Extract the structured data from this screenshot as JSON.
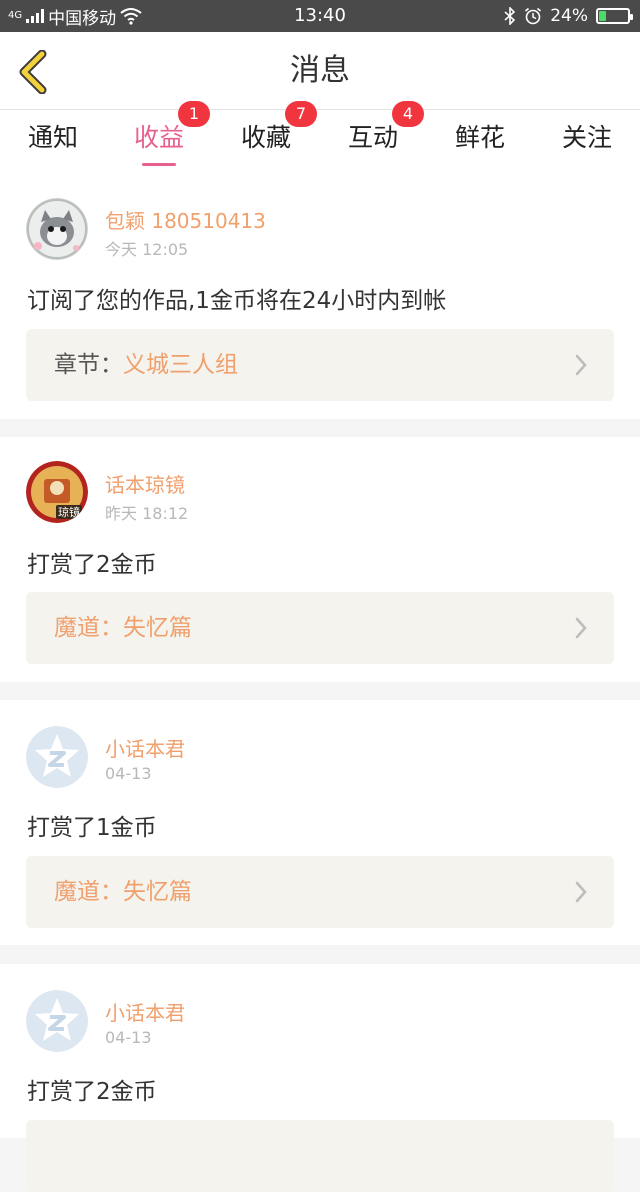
{
  "status": {
    "network": "4G",
    "carrier": "中国移动",
    "time": "13:40",
    "battery": "24%",
    "battery_level": 0.24
  },
  "header": {
    "back_icon": "chevron-left-icon",
    "title": "消息"
  },
  "tabs": [
    {
      "label": "通知",
      "badge": ""
    },
    {
      "label": "收益",
      "badge": "1",
      "active": true
    },
    {
      "label": "收藏",
      "badge": "7"
    },
    {
      "label": "互动",
      "badge": "4"
    },
    {
      "label": "鲜花",
      "badge": ""
    },
    {
      "label": "关注",
      "badge": ""
    }
  ],
  "messages": [
    {
      "user": "包颖 180510413",
      "time": "今天 12:05",
      "text": "订阅了您的作品,1金币将在24小时内到帐",
      "ref_prefix": "章节：",
      "ref_title": "义城三人组"
    },
    {
      "user": "话本琼镜",
      "time": "昨天 18:12",
      "avatar_text": "琼镜",
      "text": "打赏了2金币",
      "ref_prefix": "魔道：",
      "ref_title": "失忆篇"
    },
    {
      "user": "小话本君",
      "time": "04-13",
      "text": "打赏了1金币",
      "ref_prefix": "魔道：",
      "ref_title": "失忆篇"
    },
    {
      "user": "小话本君",
      "time": "04-13",
      "text": "打赏了2金币",
      "ref_prefix": "",
      "ref_title": ""
    }
  ],
  "colors": {
    "accent": "#e8608f",
    "badge": "#f1353f",
    "username": "#f0a06d",
    "ref_bg": "#f4f3ee",
    "back_icon": "#f2d13a"
  }
}
